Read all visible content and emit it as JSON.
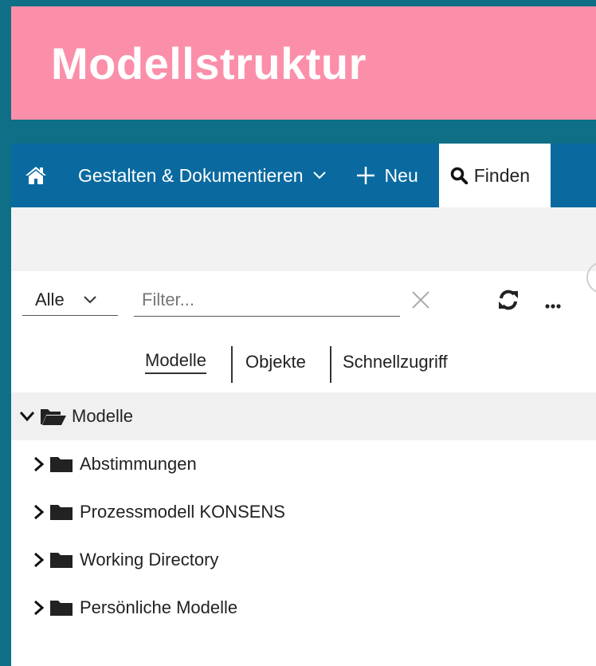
{
  "slide": {
    "title": "Modellstruktur"
  },
  "navbar": {
    "home_icon": "home-icon",
    "design_label": "Gestalten & Dokumentieren",
    "new_label": "Neu",
    "find_label": "Finden"
  },
  "toolbar": {
    "scope_value": "Alle",
    "filter_placeholder": "Filter...",
    "filter_value": ""
  },
  "tabs": [
    {
      "label": "Modelle",
      "active": true
    },
    {
      "label": "Objekte",
      "active": false
    },
    {
      "label": "Schnellzugriff",
      "active": false
    }
  ],
  "tree": {
    "root": {
      "label": "Modelle",
      "expanded": true
    },
    "items": [
      {
        "label": "Abstimmungen"
      },
      {
        "label": "Prozessmodell KONSENS"
      },
      {
        "label": "Working Directory"
      },
      {
        "label": "Persönliche Modelle"
      }
    ]
  },
  "colors": {
    "background": "#0e6f86",
    "banner": "#fb8fa9",
    "navbar": "#0a6aa0"
  }
}
